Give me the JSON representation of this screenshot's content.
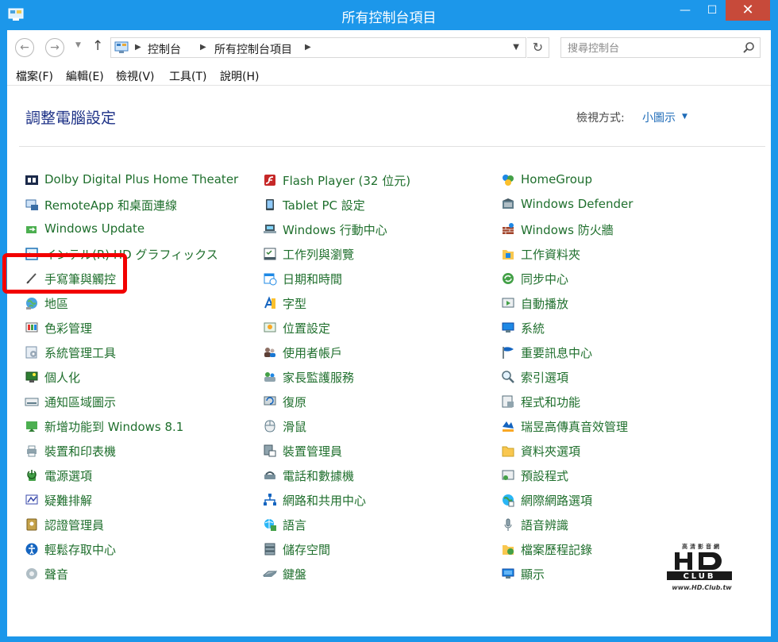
{
  "window": {
    "title": "所有控制台項目",
    "controls": {
      "minimize": "—",
      "maximize": "☐",
      "close": "✕"
    }
  },
  "address": {
    "breadcrumbs": [
      "控制台",
      "所有控制台項目"
    ],
    "search_placeholder": "搜尋控制台"
  },
  "menu": [
    "檔案(F)",
    "編輯(E)",
    "檢視(V)",
    "工具(T)",
    "說明(H)"
  ],
  "header": {
    "title": "調整電腦設定",
    "view_by_label": "檢視方式:",
    "view_by_value": "小圖示"
  },
  "colors": {
    "link": "#1f6f2d",
    "heading": "#1e3287",
    "titlebar": "#1c97ea",
    "highlight": "#f20000"
  },
  "columns": [
    [
      {
        "label": "Dolby Digital Plus Home Theater",
        "icon": "dolby-icon"
      },
      {
        "label": "RemoteApp 和桌面連線",
        "icon": "remoteapp-icon"
      },
      {
        "label": "Windows Update",
        "icon": "windows-update-icon"
      },
      {
        "label": "インテル(R) HD グラフィックス",
        "icon": "intel-graphics-icon"
      },
      {
        "label": "手寫筆與觸控",
        "icon": "pen-touch-icon"
      },
      {
        "label": "地區",
        "icon": "region-globe-icon"
      },
      {
        "label": "色彩管理",
        "icon": "color-management-icon"
      },
      {
        "label": "系統管理工具",
        "icon": "admin-tools-icon"
      },
      {
        "label": "個人化",
        "icon": "personalization-icon"
      },
      {
        "label": "通知區域圖示",
        "icon": "notification-icon"
      },
      {
        "label": "新增功能到 Windows 8.1",
        "icon": "add-features-icon"
      },
      {
        "label": "裝置和印表機",
        "icon": "devices-printers-icon"
      },
      {
        "label": "電源選項",
        "icon": "power-options-icon"
      },
      {
        "label": "疑難排解",
        "icon": "troubleshooting-icon"
      },
      {
        "label": "認證管理員",
        "icon": "credential-manager-icon"
      },
      {
        "label": "輕鬆存取中心",
        "icon": "ease-of-access-icon"
      },
      {
        "label": "聲音",
        "icon": "sound-icon"
      }
    ],
    [
      {
        "label": "Flash Player (32 位元)",
        "icon": "flash-player-icon"
      },
      {
        "label": "Tablet PC 設定",
        "icon": "tablet-pc-icon"
      },
      {
        "label": "Windows 行動中心",
        "icon": "mobility-center-icon"
      },
      {
        "label": "工作列與瀏覽",
        "icon": "taskbar-icon"
      },
      {
        "label": "日期和時間",
        "icon": "date-time-icon"
      },
      {
        "label": "字型",
        "icon": "fonts-icon"
      },
      {
        "label": "位置設定",
        "icon": "location-icon"
      },
      {
        "label": "使用者帳戶",
        "icon": "user-accounts-icon"
      },
      {
        "label": "家長監護服務",
        "icon": "family-safety-icon"
      },
      {
        "label": "復原",
        "icon": "recovery-icon"
      },
      {
        "label": "滑鼠",
        "icon": "mouse-icon"
      },
      {
        "label": "裝置管理員",
        "icon": "device-manager-icon"
      },
      {
        "label": "電話和數據機",
        "icon": "phone-modem-icon"
      },
      {
        "label": "網路和共用中心",
        "icon": "network-sharing-icon"
      },
      {
        "label": "語言",
        "icon": "language-icon"
      },
      {
        "label": "儲存空間",
        "icon": "storage-spaces-icon"
      },
      {
        "label": "鍵盤",
        "icon": "keyboard-icon"
      }
    ],
    [
      {
        "label": "HomeGroup",
        "icon": "homegroup-icon"
      },
      {
        "label": "Windows Defender",
        "icon": "defender-icon"
      },
      {
        "label": "Windows 防火牆",
        "icon": "firewall-icon"
      },
      {
        "label": "工作資料夾",
        "icon": "work-folders-icon"
      },
      {
        "label": "同步中心",
        "icon": "sync-center-icon"
      },
      {
        "label": "自動播放",
        "icon": "autoplay-icon"
      },
      {
        "label": "系統",
        "icon": "system-icon"
      },
      {
        "label": "重要訊息中心",
        "icon": "action-center-icon"
      },
      {
        "label": "索引選項",
        "icon": "indexing-icon"
      },
      {
        "label": "程式和功能",
        "icon": "programs-features-icon"
      },
      {
        "label": "瑞昱高傳真音效管理",
        "icon": "realtek-audio-icon"
      },
      {
        "label": "資料夾選項",
        "icon": "folder-options-icon"
      },
      {
        "label": "預設程式",
        "icon": "default-programs-icon"
      },
      {
        "label": "網際網路選項",
        "icon": "internet-options-icon"
      },
      {
        "label": "語音辨識",
        "icon": "speech-recognition-icon"
      },
      {
        "label": "檔案歷程記錄",
        "icon": "file-history-icon"
      },
      {
        "label": "顯示",
        "icon": "display-icon"
      }
    ]
  ],
  "watermark": {
    "top_text": "高清影音網",
    "url": "www.HD.Club.tw",
    "logo_text": "HD CLUB"
  }
}
